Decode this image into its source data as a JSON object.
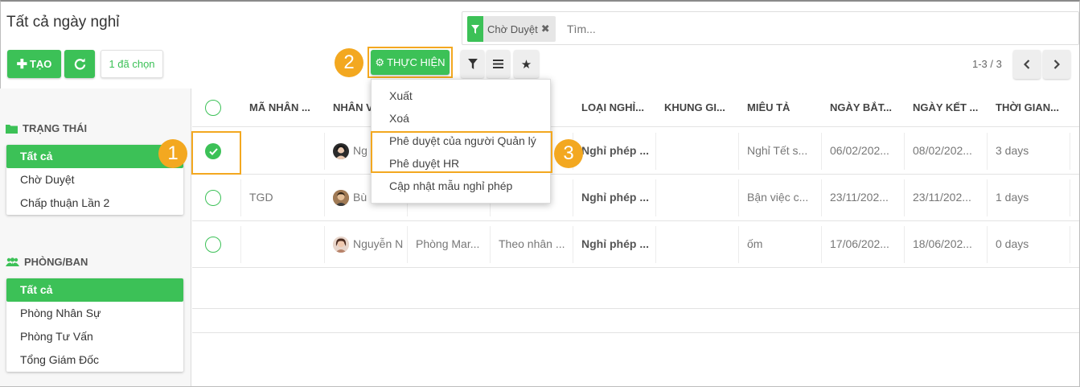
{
  "page_title": "Tất cả ngày nghỉ",
  "toolbar": {
    "create_label": "TẠO",
    "selected_label": "1 đã chọn",
    "action_label": "THỰC HIỆN"
  },
  "search": {
    "facet_label": "Chờ Duyệt",
    "placeholder": "Tìm..."
  },
  "pager": {
    "text": "1-3 / 3"
  },
  "annotations": {
    "one": "1",
    "two": "2",
    "three": "3"
  },
  "action_menu": {
    "items": [
      "Xuất",
      "Xoá",
      "Phê duyệt của người Quản lý",
      "Phê duyệt HR",
      "Cập nhật mẫu nghỉ phép"
    ]
  },
  "sidebar": {
    "status_heading": "TRẠNG THÁI",
    "status_items": [
      "Tất cả",
      "Chờ Duyệt",
      "Chấp thuận Lần 2"
    ],
    "dept_heading": "PHÒNG/BAN",
    "dept_items": [
      "Tất cả",
      "Phòng Nhân Sự",
      "Phòng Tư Vấn",
      "Tổng Giám Đốc"
    ]
  },
  "table": {
    "columns": [
      "MÃ NHÂN ...",
      "NHÂN V",
      "",
      "",
      "LOẠI NGHỈ...",
      "KHUNG GI...",
      "MIÊU TẢ",
      "NGÀY BẮT...",
      "NGÀY KẾT ...",
      "THỜI GIAN..."
    ],
    "rows": [
      {
        "checked": true,
        "code": "",
        "employee": "Ng",
        "department": "",
        "assign": "",
        "leave_type": "Nghỉ phép ...",
        "slot": "",
        "description": "Nghỉ Tết s...",
        "start": "06/02/202...",
        "end": "08/02/202...",
        "duration": "3 days"
      },
      {
        "checked": false,
        "code": "TGD",
        "employee": "Bù",
        "department": "",
        "assign": "",
        "leave_type": "Nghỉ phép ...",
        "slot": "",
        "description": "Bận việc c...",
        "start": "23/11/202...",
        "end": "23/11/202...",
        "duration": "1 days"
      },
      {
        "checked": false,
        "code": "",
        "employee": "Nguyễn N",
        "department": "Phòng Mar...",
        "assign": "Theo nhân ...",
        "leave_type": "Nghỉ phép ...",
        "slot": "",
        "description": "ốm",
        "start": "17/06/202...",
        "end": "18/06/202...",
        "duration": "0 days"
      }
    ]
  },
  "colors": {
    "accent": "#3cc157",
    "highlight": "#f3a820"
  }
}
